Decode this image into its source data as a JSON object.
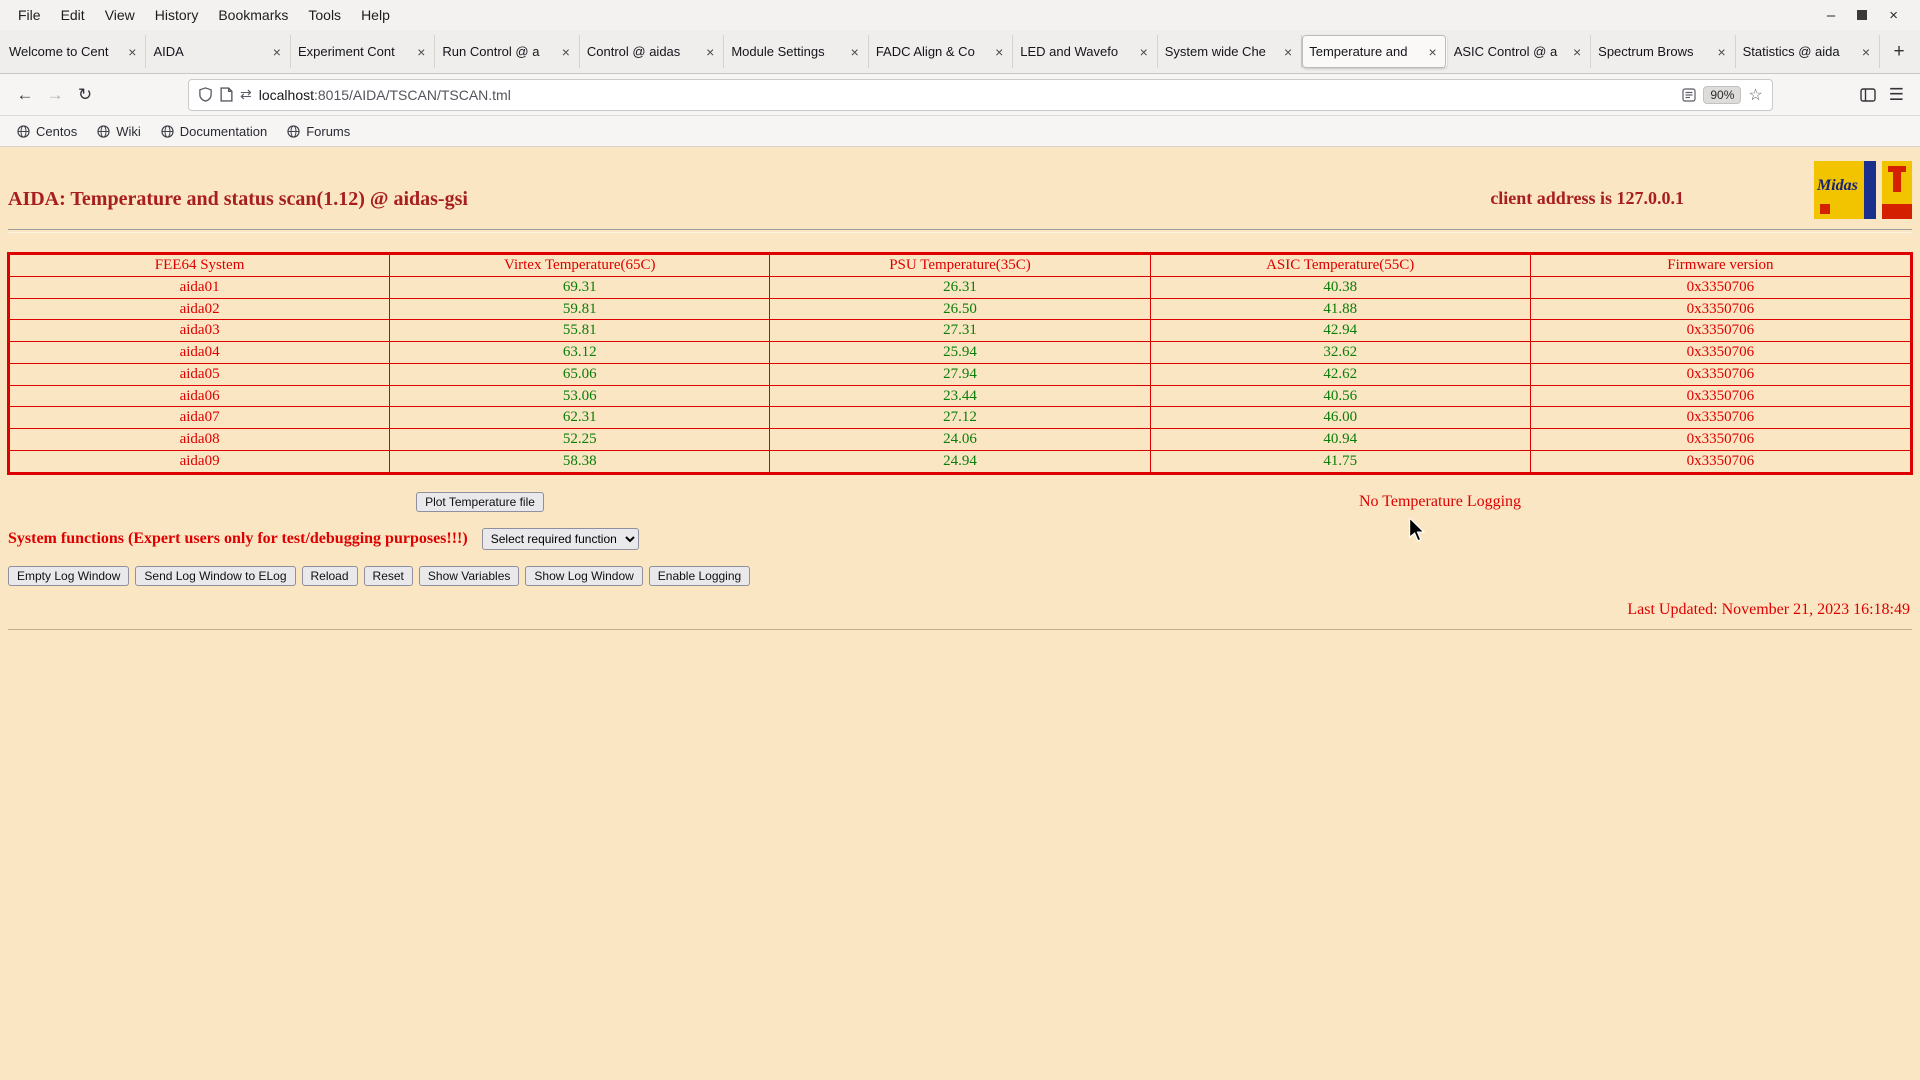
{
  "theme": {
    "page_bg": "#FAE6C3",
    "accent_red": "#DE0000",
    "temp_green": "#0A7D0A",
    "title_red": "#A81E1E"
  },
  "chrome": {
    "menubar": {
      "items": [
        "File",
        "Edit",
        "View",
        "History",
        "Bookmarks",
        "Tools",
        "Help"
      ],
      "window": {
        "minimize": "–",
        "close": "×"
      }
    },
    "tabs": {
      "close_glyph": "×",
      "new_tab_glyph": "+",
      "items": [
        {
          "label": "Welcome to Cent",
          "active": false
        },
        {
          "label": "AIDA",
          "active": false
        },
        {
          "label": "Experiment Cont",
          "active": false
        },
        {
          "label": "Run Control @ a",
          "active": false
        },
        {
          "label": "Control @ aidas",
          "active": false
        },
        {
          "label": "Module Settings",
          "active": false
        },
        {
          "label": "FADC Align & Co",
          "active": false
        },
        {
          "label": "LED and Wavefo",
          "active": false
        },
        {
          "label": "System wide Che",
          "active": false
        },
        {
          "label": "Temperature and",
          "active": true
        },
        {
          "label": "ASIC Control @ a",
          "active": false
        },
        {
          "label": "Spectrum Brows",
          "active": false
        },
        {
          "label": "Statistics @ aida",
          "active": false
        }
      ]
    },
    "nav": {
      "back_glyph": "←",
      "forward_glyph": "→",
      "reload_glyph": "↻",
      "swap_glyph": "⇄",
      "star_glyph": "☆",
      "menu_glyph": "☰",
      "zoom_badge": "90%",
      "url_host": "localhost",
      "url_rest": ":8015/AIDA/TSCAN/TSCAN.tml"
    },
    "bookmarks": {
      "items": [
        "Centos",
        "Wiki",
        "Documentation",
        "Forums"
      ]
    }
  },
  "page": {
    "title": "AIDA: Temperature and status scan(1.12) @ aidas-gsi",
    "client_address": "client address is 127.0.0.1",
    "logo_midas_text": "Midas",
    "table": {
      "headers": [
        "FEE64 System",
        "Virtex Temperature(65C)",
        "PSU Temperature(35C)",
        "ASIC Temperature(55C)",
        "Firmware version"
      ],
      "rows": [
        {
          "system": "aida01",
          "virtex": "69.31",
          "psu": "26.31",
          "asic": "40.38",
          "firmware": "0x3350706"
        },
        {
          "system": "aida02",
          "virtex": "59.81",
          "psu": "26.50",
          "asic": "41.88",
          "firmware": "0x3350706"
        },
        {
          "system": "aida03",
          "virtex": "55.81",
          "psu": "27.31",
          "asic": "42.94",
          "firmware": "0x3350706"
        },
        {
          "system": "aida04",
          "virtex": "63.12",
          "psu": "25.94",
          "asic": "32.62",
          "firmware": "0x3350706"
        },
        {
          "system": "aida05",
          "virtex": "65.06",
          "psu": "27.94",
          "asic": "42.62",
          "firmware": "0x3350706"
        },
        {
          "system": "aida06",
          "virtex": "53.06",
          "psu": "23.44",
          "asic": "40.56",
          "firmware": "0x3350706"
        },
        {
          "system": "aida07",
          "virtex": "62.31",
          "psu": "27.12",
          "asic": "46.00",
          "firmware": "0x3350706"
        },
        {
          "system": "aida08",
          "virtex": "52.25",
          "psu": "24.06",
          "asic": "40.94",
          "firmware": "0x3350706"
        },
        {
          "system": "aida09",
          "virtex": "58.38",
          "psu": "24.94",
          "asic": "41.75",
          "firmware": "0x3350706"
        }
      ]
    },
    "plot_button": "Plot Temperature file",
    "no_logging": "No Temperature Logging",
    "system_functions_label": "System functions (Expert users only for test/debugging purposes!!!)",
    "function_select_value": "Select required function",
    "log_buttons": [
      "Empty Log Window",
      "Send Log Window to ELog",
      "Reload",
      "Reset",
      "Show Variables",
      "Show Log Window",
      "Enable Logging"
    ],
    "last_updated": "Last Updated: November 21, 2023 16:18:49"
  }
}
